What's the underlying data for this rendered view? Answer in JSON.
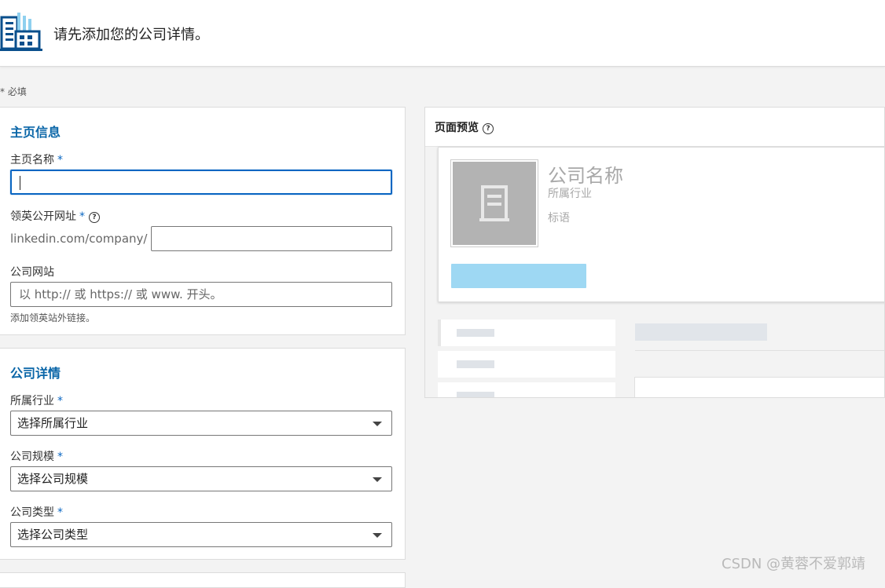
{
  "header": {
    "title": "请先添加您的公司详情。",
    "logo_icon": "company-building-icon"
  },
  "required_note": "* 必填",
  "page_info": {
    "section_title": "主页信息",
    "page_name": {
      "label": "主页名称",
      "star": "*",
      "value": "",
      "focused": true
    },
    "public_url": {
      "label": "领英公开网址",
      "star": "*",
      "help_icon": "question-circle-icon",
      "prefix": "linkedin.com/company/",
      "value": ""
    },
    "website": {
      "label": "公司网站",
      "placeholder": "以 http:// 或 https:// 或 www. 开头。",
      "hint": "添加领英站外链接。"
    }
  },
  "company_details": {
    "section_title": "公司详情",
    "industry": {
      "label": "所属行业",
      "star": "*",
      "selected": "选择所属行业"
    },
    "size": {
      "label": "公司规模",
      "star": "*",
      "selected": "选择公司规模"
    },
    "type": {
      "label": "公司类型",
      "star": "*",
      "selected": "选择公司类型"
    }
  },
  "preview": {
    "title": "页面预览",
    "help_icon": "question-circle-icon",
    "company_name": "公司名称",
    "industry": "所属行业",
    "tagline": "标语",
    "logo_placeholder_icon": "building-placeholder-icon",
    "button_color": "#9ed8f3"
  },
  "watermark": "CSDN @黄蓉不爱郭靖",
  "colors": {
    "accent": "#0a66c2",
    "section_title": "#0a66a8"
  }
}
